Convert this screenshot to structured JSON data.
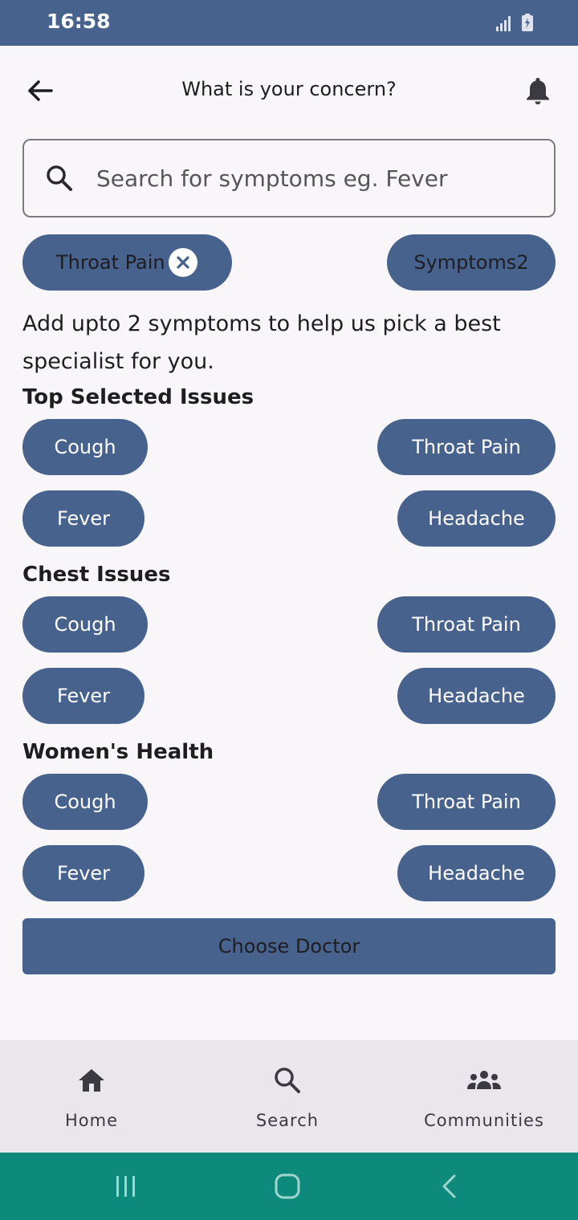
{
  "status_bar": {
    "time": "16:58",
    "signal_icon": "signal-icon",
    "battery_icon": "battery-charging-icon"
  },
  "header": {
    "title": "What is your concern?",
    "back_icon": "arrow-left-icon",
    "notification_icon": "bell-icon"
  },
  "search": {
    "placeholder": "Search for symptoms eg. Fever",
    "value": "",
    "icon": "search-icon"
  },
  "selected_symptoms": [
    {
      "label": "Throat Pain",
      "removable": true
    },
    {
      "label": "Symptoms2",
      "removable": false
    }
  ],
  "info_text": "Add upto 2 symptoms to help us pick a best specialist for you.",
  "sections": [
    {
      "title": "Top Selected Issues",
      "chips": [
        "Cough",
        "Throat Pain",
        "Fever",
        "Headache"
      ]
    },
    {
      "title": "Chest Issues",
      "chips": [
        "Cough",
        "Throat Pain",
        "Fever",
        "Headache"
      ]
    },
    {
      "title": "Women's Health",
      "chips": [
        "Cough",
        "Throat Pain",
        "Fever",
        "Headache"
      ]
    }
  ],
  "choose_button": "Choose Doctor",
  "bottom_nav": [
    {
      "label": "Home",
      "icon": "home-icon"
    },
    {
      "label": "Search",
      "icon": "search-icon"
    },
    {
      "label": "Communities",
      "icon": "groups-icon"
    }
  ],
  "system_nav": {
    "recents_icon": "recents-icon",
    "home_icon": "home-circle-icon",
    "back_icon": "back-chevron-icon"
  },
  "colors": {
    "primary": "#48628e",
    "background": "#f8f6f8",
    "nav_bg": "#e9e7ec",
    "system_nav": "#0e8a7c"
  }
}
